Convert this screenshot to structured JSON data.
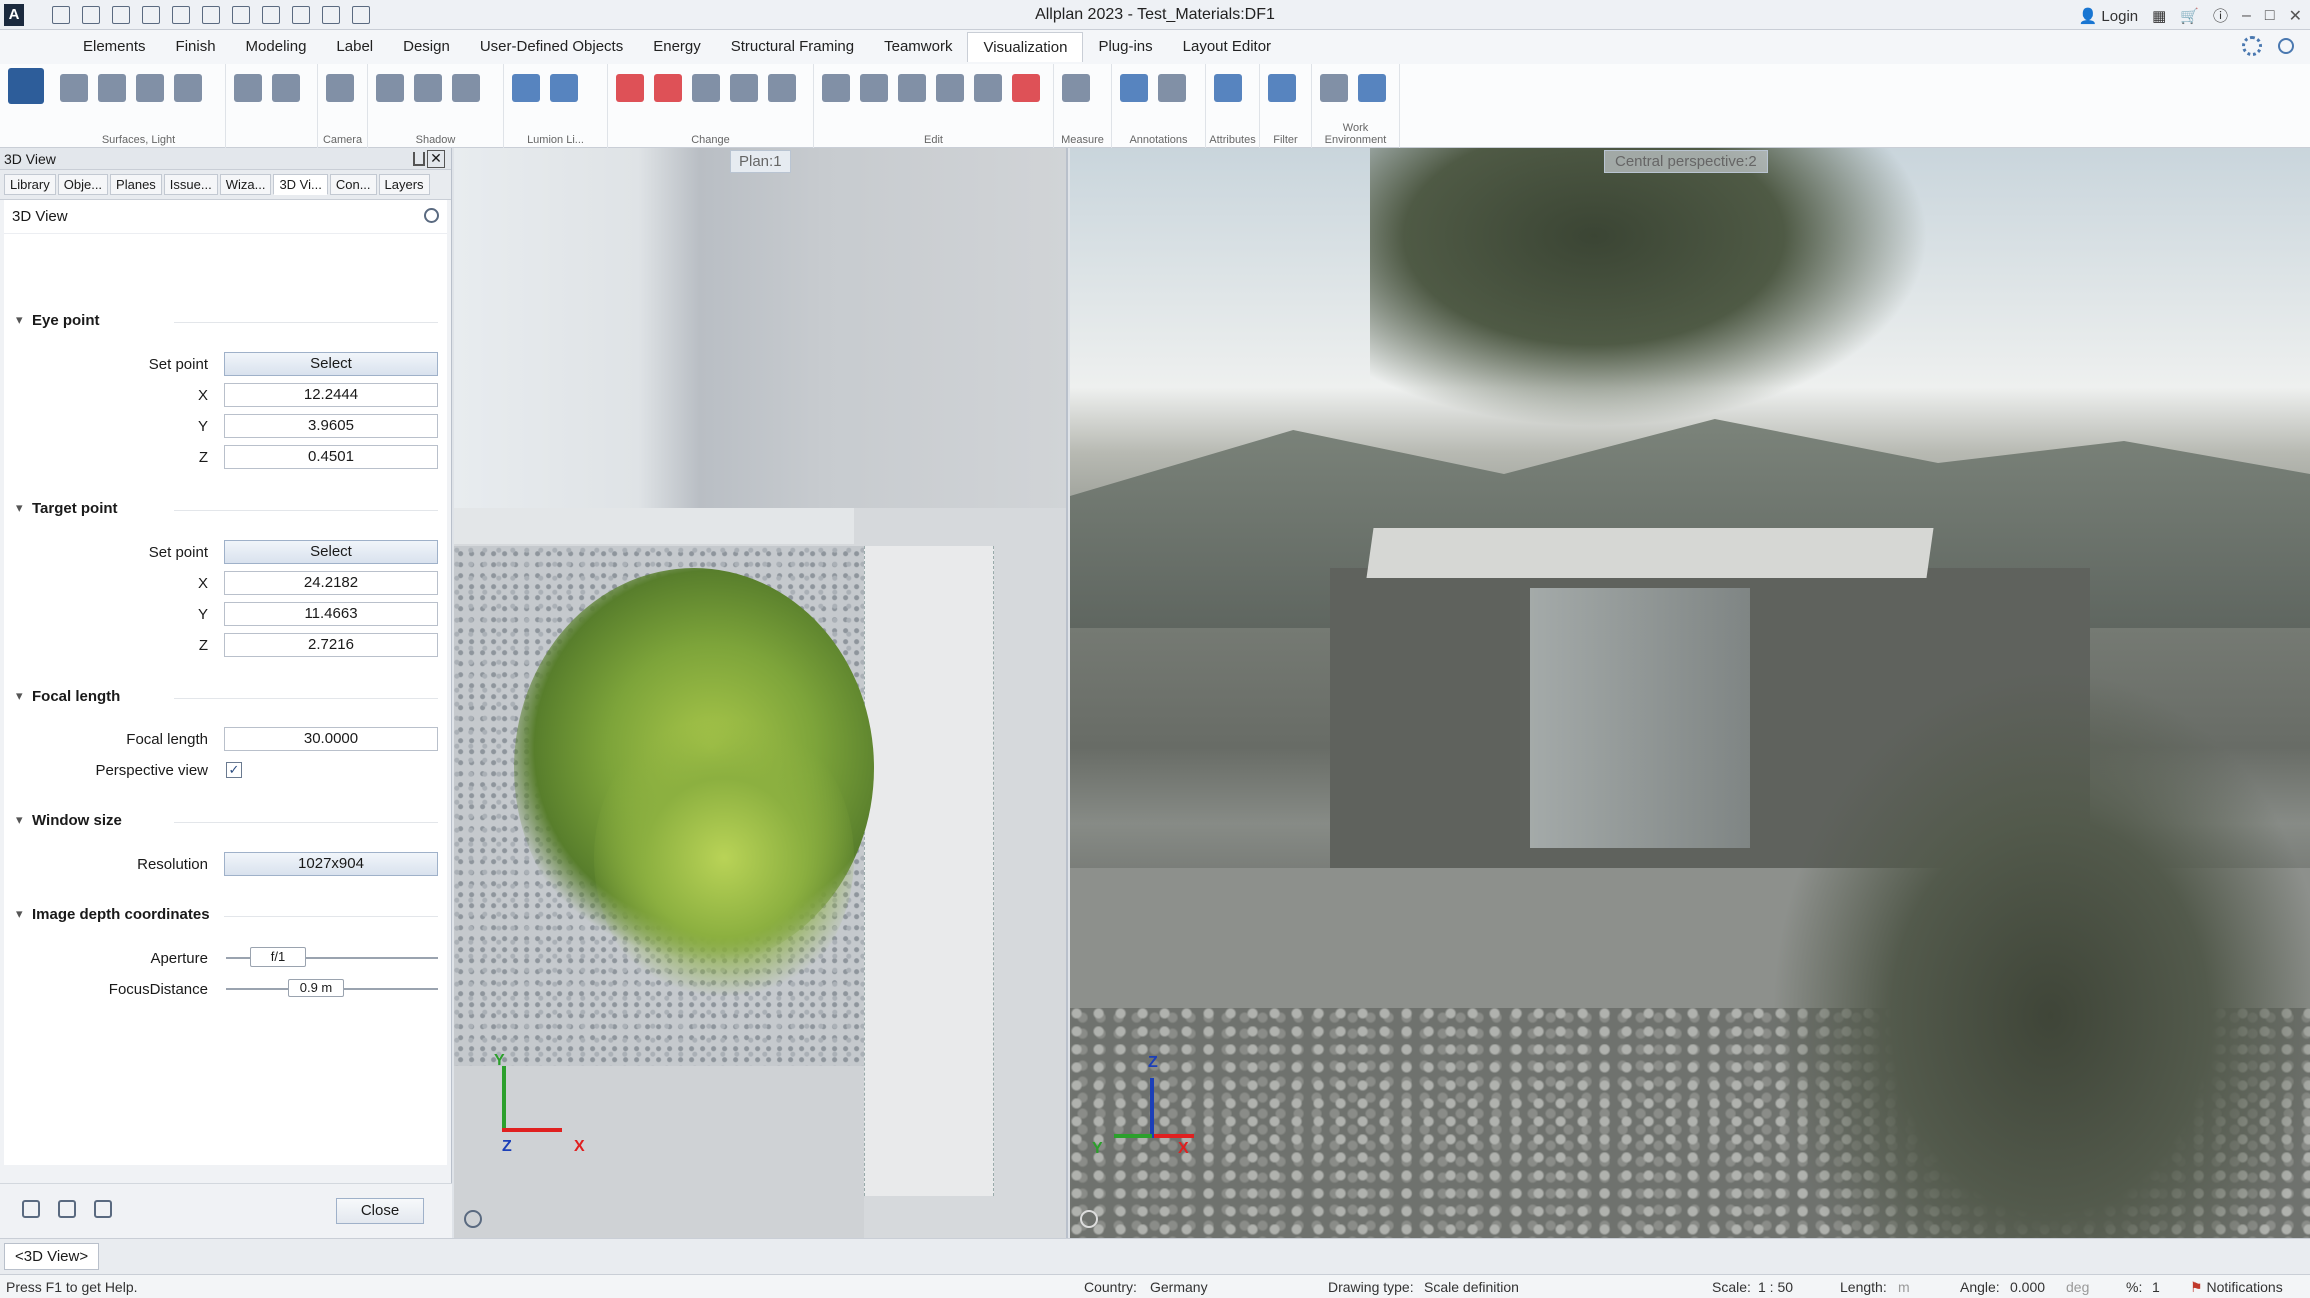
{
  "window": {
    "title": "Allplan 2023 - Test_Materials:DF1",
    "login": "Login"
  },
  "ribbon": {
    "tabs": [
      "Elements",
      "Finish",
      "Modeling",
      "Label",
      "Design",
      "User-Defined Objects",
      "Energy",
      "Structural Framing",
      "Teamwork",
      "Visualization",
      "Plug-ins",
      "Layout Editor"
    ],
    "active_tab": "Visualization",
    "groups": [
      "Surfaces, Light",
      "Camera",
      "Shadow",
      "Lumion Li...",
      "Change",
      "Edit",
      "Measure",
      "Annotations",
      "Attributes",
      "Filter",
      "Work Environment"
    ]
  },
  "panel": {
    "header": "3D View",
    "tabs": [
      "Library",
      "Obje...",
      "Planes",
      "Issue...",
      "Wiza...",
      "3D Vi...",
      "Con...",
      "Layers"
    ],
    "active_tab": "3D Vi...",
    "title": "3D View",
    "eye_point": {
      "section": "Eye point",
      "set_point_label": "Set point",
      "set_point_button": "Select",
      "x_label": "X",
      "x": "12.2444",
      "y_label": "Y",
      "y": "3.9605",
      "z_label": "Z",
      "z": "0.4501"
    },
    "target_point": {
      "section": "Target point",
      "set_point_label": "Set point",
      "set_point_button": "Select",
      "x_label": "X",
      "x": "24.2182",
      "y_label": "Y",
      "y": "11.4663",
      "z_label": "Z",
      "z": "2.7216"
    },
    "focal": {
      "section": "Focal length",
      "label": "Focal length",
      "value": "30.0000",
      "perspective_label": "Perspective view",
      "perspective_checked": "✓"
    },
    "window_size": {
      "section": "Window size",
      "resolution_label": "Resolution",
      "resolution": "1027x904"
    },
    "depth": {
      "section": "Image depth coordinates",
      "aperture_label": "Aperture",
      "aperture": "f/1",
      "focus_label": "FocusDistance",
      "focus": "0.9 m"
    },
    "close_button": "Close"
  },
  "viewports": {
    "plan_label": "Plan:1",
    "persp_label": "Central perspective:2",
    "axes": {
      "x": "X",
      "y": "Y",
      "z": "Z"
    }
  },
  "layout_tab": "<3D View>",
  "status": {
    "help": "Press F1 to get Help.",
    "country_label": "Country:",
    "country": "Germany",
    "drawing_type_label": "Drawing type:",
    "drawing_type": "Scale definition",
    "scale_label": "Scale:",
    "scale": "1 : 50",
    "length_label": "Length:",
    "length_unit": "m",
    "angle_label": "Angle:",
    "angle": "0.000",
    "angle_unit": "deg",
    "percent_label": "%:",
    "percent": "1",
    "notifications": "Notifications"
  }
}
